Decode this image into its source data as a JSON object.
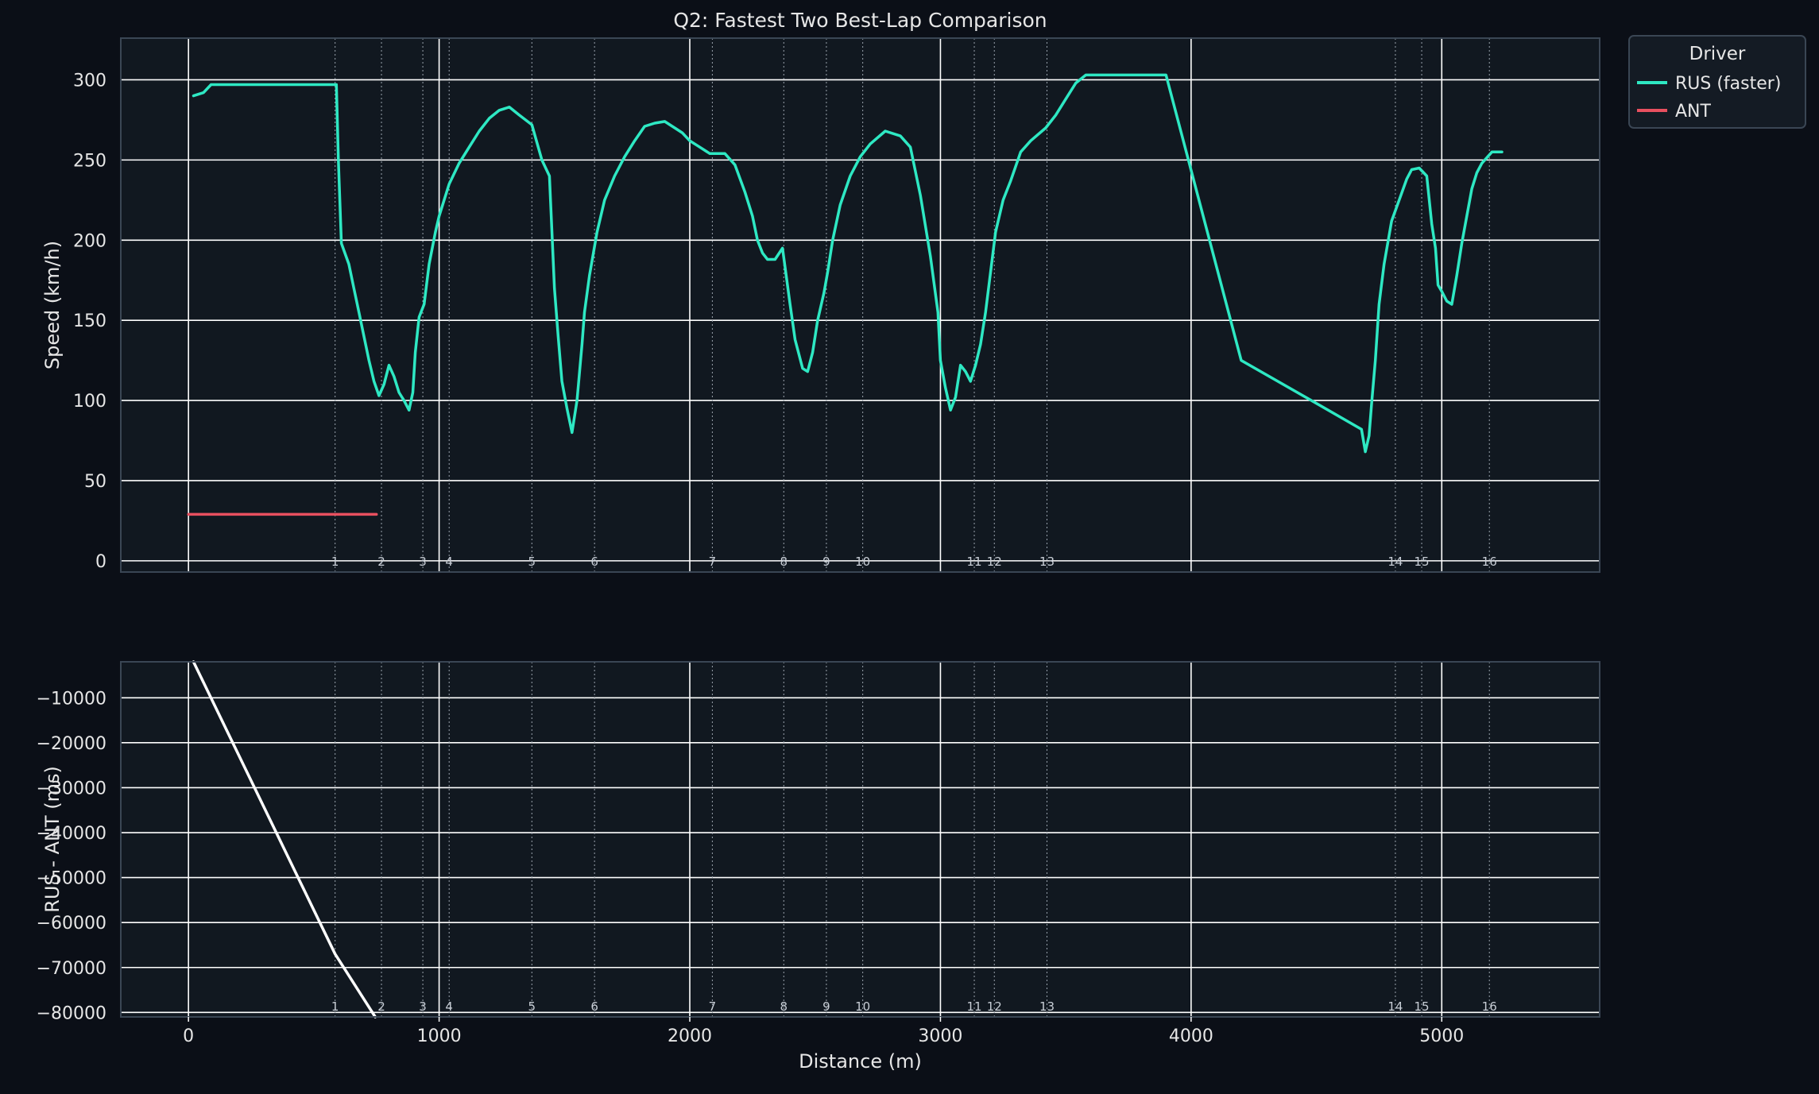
{
  "chart_data": {
    "type": "line",
    "title": "Q2: Fastest Two Best-Lap Comparison",
    "xlabel": "Distance (m)",
    "xlim": [
      -270,
      5630
    ],
    "x_ticks": [
      0,
      1000,
      2000,
      3000,
      4000,
      5000
    ],
    "grid": true,
    "colors": {
      "background": "#0b0f17",
      "plot_background": "#111820",
      "grid": "#ffffff",
      "text": "#e6e6e6",
      "rus": "#2ee8c3",
      "ant": "#e8505f",
      "delta": "#ffffff",
      "spine": "#3a4654",
      "corner_line": "#9aa3ad"
    },
    "corners": [
      {
        "label": "1",
        "x": 585
      },
      {
        "label": "2",
        "x": 770
      },
      {
        "label": "3",
        "x": 935
      },
      {
        "label": "4",
        "x": 1040
      },
      {
        "label": "5",
        "x": 1370
      },
      {
        "label": "6",
        "x": 1620
      },
      {
        "label": "7",
        "x": 2090
      },
      {
        "label": "8",
        "x": 2375
      },
      {
        "label": "9",
        "x": 2545
      },
      {
        "label": "10",
        "x": 2690
      },
      {
        "label": "11",
        "x": 3135
      },
      {
        "label": "12",
        "x": 3215
      },
      {
        "label": "13",
        "x": 3425
      },
      {
        "label": "14",
        "x": 4815
      },
      {
        "label": "15",
        "x": 4920
      },
      {
        "label": "16",
        "x": 5190
      }
    ],
    "legend": {
      "title": "Driver",
      "placement": "outside-top-right",
      "entries": [
        "RUS (faster)",
        "ANT"
      ]
    },
    "panels": [
      {
        "ylabel": "Speed (km/h)",
        "ylim": [
          -7,
          326
        ],
        "y_ticks": [
          0,
          50,
          100,
          150,
          200,
          250,
          300
        ],
        "y_tick_labels": [
          "0",
          "50",
          "100",
          "150",
          "200",
          "250",
          "300"
        ],
        "series": [
          {
            "name": "RUS (faster)",
            "color": "#2ee8c3",
            "x": [
              20,
              40,
              60,
              90,
              120,
              300,
              590,
              598,
              610,
              640,
              660,
              680,
              700,
              720,
              740,
              760,
              780,
              800,
              820,
              840,
              860,
              880,
              895,
              905,
              920,
              940,
              960,
              985,
              1000,
              1040,
              1080,
              1120,
              1160,
              1200,
              1240,
              1280,
              1320,
              1370,
              1410,
              1440,
              1460,
              1475,
              1490,
              1510,
              1530,
              1550,
              1570,
              1580,
              1600,
              1630,
              1660,
              1700,
              1740,
              1780,
              1820,
              1860,
              1900,
              1940,
              1970,
              2000,
              2040,
              2080,
              2140,
              2180,
              2220,
              2250,
              2270,
              2290,
              2310,
              2340,
              2370,
              2400,
              2420,
              2450,
              2470,
              2490,
              2510,
              2535,
              2550,
              2570,
              2600,
              2640,
              2680,
              2720,
              2780,
              2840,
              2880,
              2920,
              2960,
              2990,
              3000,
              3020,
              3040,
              3060,
              3080,
              3100,
              3120,
              3140,
              3160,
              3180,
              3200,
              3220,
              3250,
              3280,
              3320,
              3360,
              3420,
              3460,
              3500,
              3540,
              3580,
              3620,
              3660,
              3700,
              3900,
              4200,
              4480,
              4680,
              4695,
              4710,
              4720,
              4735,
              4750,
              4770,
              4800,
              4830,
              4860,
              4880,
              4910,
              4940,
              4960,
              4975,
              4985,
              5000,
              5020,
              5040,
              5060,
              5080,
              5100,
              5120,
              5140,
              5160,
              5200,
              5240,
              5280,
              5320,
              5340,
              5370
            ],
            "y": [
              290,
              291,
              292,
              297,
              297,
              297,
              297,
              250,
              198,
              185,
              170,
              155,
              140,
              125,
              112,
              103,
              110,
              122,
              115,
              105,
              100,
              94,
              105,
              130,
              152,
              160,
              185,
              205,
              215,
              235,
              248,
              258,
              268,
              276,
              281,
              283,
              278,
              272,
              250,
              240,
              170,
              140,
              112,
              95,
              80,
              100,
              135,
              155,
              178,
              205,
              225,
              240,
              252,
              262,
              271,
              273,
              274,
              270,
              267,
              262,
              258,
              254,
              254,
              247,
              230,
              215,
              200,
              192,
              188,
              188,
              195,
              160,
              138,
              120,
              118,
              130,
              150,
              167,
              180,
              200,
              222,
              240,
              252,
              260,
              268,
              265,
              258,
              228,
              190,
              155,
              125,
              108,
              94,
              102,
              122,
              118,
              112,
              122,
              135,
              155,
              180,
              205,
              225,
              237,
              255,
              262,
              270,
              278,
              288,
              298,
              303,
              303,
              303,
              303,
              303,
              125,
              100,
              82,
              68,
              78,
              98,
              125,
              160,
              185,
              212,
              225,
              238,
              244,
              245,
              240,
              210,
              195,
              172,
              168,
              162,
              160,
              178,
              198,
              215,
              232,
              242,
              248,
              255,
              255
            ]
          },
          {
            "name": "ANT",
            "color": "#e8505f",
            "x": [
              0,
              750
            ],
            "y": [
              29,
              29
            ]
          }
        ]
      },
      {
        "ylabel": "RUS - ANT (ms)",
        "ylim": [
          -81000,
          -2000
        ],
        "y_ticks": [
          -10000,
          -20000,
          -30000,
          -40000,
          -50000,
          -60000,
          -70000,
          -80000
        ],
        "y_tick_labels": [
          "−10000",
          "−20000",
          "−30000",
          "−40000",
          "−50000",
          "−60000",
          "−70000",
          "−80000"
        ],
        "series": [
          {
            "name": "RUS - ANT",
            "color": "#ffffff",
            "x": [
              20,
              585,
              745
            ],
            "y": [
              -2000,
              -67000,
              -81000
            ]
          }
        ]
      }
    ]
  }
}
